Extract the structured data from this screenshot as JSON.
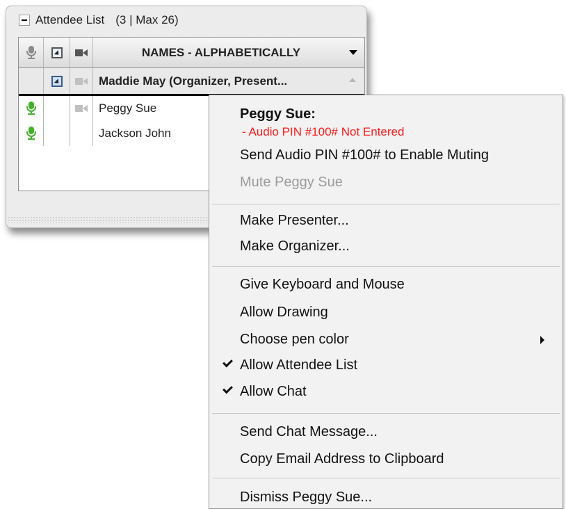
{
  "panel": {
    "title": "Attendee List",
    "count": "(3 | Max 26)",
    "icons": {
      "collapse": "minus-icon",
      "mic": "microphone-icon",
      "screen": "screen-share-icon",
      "camera": "camera-icon"
    },
    "columns": {
      "names_header": "NAMES - ALPHABETICALLY"
    },
    "rows": [
      {
        "name": "Maddie May (Organizer, Present...",
        "role": "organizer"
      },
      {
        "name": "Peggy Sue",
        "role": "attendee"
      },
      {
        "name": "Jackson John",
        "role": "attendee"
      }
    ]
  },
  "menu": {
    "title": "Peggy Sue:",
    "warning": "- Audio PIN #100# Not Entered",
    "items": {
      "send_pin": "Send Audio PIN #100# to Enable Muting",
      "mute": "Mute Peggy Sue",
      "make_presenter": "Make Presenter...",
      "make_organizer": "Make Organizer...",
      "give_keyboard": "Give Keyboard and Mouse",
      "allow_drawing": "Allow Drawing",
      "choose_pen": "Choose pen color",
      "allow_attendee_list": "Allow Attendee List",
      "allow_chat": "Allow Chat",
      "send_chat": "Send Chat Message...",
      "copy_email": "Copy Email Address to Clipboard",
      "dismiss": "Dismiss Peggy Sue..."
    },
    "checked": [
      "allow_attendee_list",
      "allow_chat"
    ],
    "disabled": [
      "mute"
    ],
    "colors": {
      "warning": "#ff1a1a",
      "disabled_text": "#9b9b9b",
      "mic_active": "#43b02a"
    }
  }
}
